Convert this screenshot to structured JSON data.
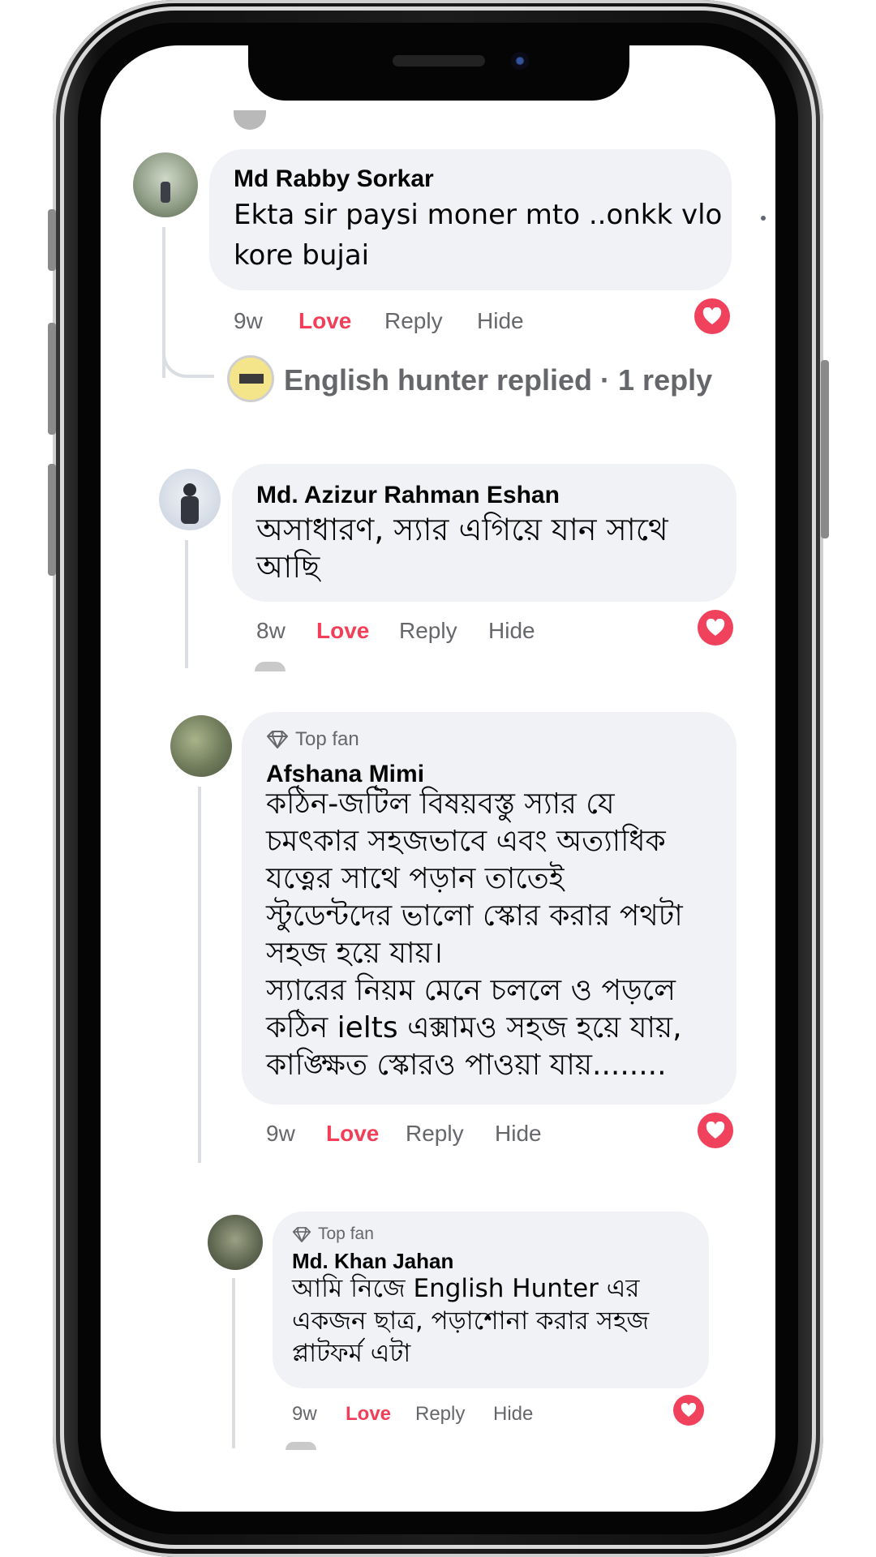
{
  "comments": [
    {
      "author": "Md Rabby Sorkar",
      "text": [
        "Ekta sir paysi moner mto ..onkk vlo",
        "kore bujai"
      ],
      "time": "9w",
      "love": "Love",
      "reply": "Reply",
      "hide": "Hide",
      "replied_summary": "English hunter replied · 1 reply"
    },
    {
      "author": "Md. Azizur Rahman Eshan",
      "text": [
        "অসাধারণ, স্যার এগিয়ে যান সাথে",
        "আছি"
      ],
      "time": "8w",
      "love": "Love",
      "reply": "Reply",
      "hide": "Hide"
    },
    {
      "badge": "Top fan",
      "author": "Afshana Mimi",
      "text": [
        "কঠিন-জটিল বিষয়বস্তু স্যার যে",
        "চমৎকার সহজভাবে এবং অত্যাধিক",
        "যত্নের সাথে পড়ান তাতেই",
        "স্টুডেন্টদের ভালো স্কোর করার পথটা",
        "সহজ হয়ে যায়।",
        "স্যারের নিয়ম মেনে চললে ও পড়লে",
        "কঠিন ielts এক্সামও সহজ হয়ে যায়,",
        "কাঙ্ক্ষিত স্কোরও পাওয়া যায়........"
      ],
      "time": "9w",
      "love": "Love",
      "reply": "Reply",
      "hide": "Hide"
    },
    {
      "badge": "Top fan",
      "author": "Md. Khan Jahan",
      "text": [
        "আমি নিজে English Hunter এর",
        "একজন ছাত্র, পড়াশোনা করার সহজ",
        "প্লাটফর্ম এটা"
      ],
      "time": "9w",
      "love": "Love",
      "reply": "Reply",
      "hide": "Hide"
    }
  ],
  "colors": {
    "love": "#f33e58",
    "bubble": "#f0f2f5",
    "meta": "#65676b",
    "heart": "#f0425c"
  },
  "icons": [
    "heart-icon",
    "diamond-icon"
  ]
}
